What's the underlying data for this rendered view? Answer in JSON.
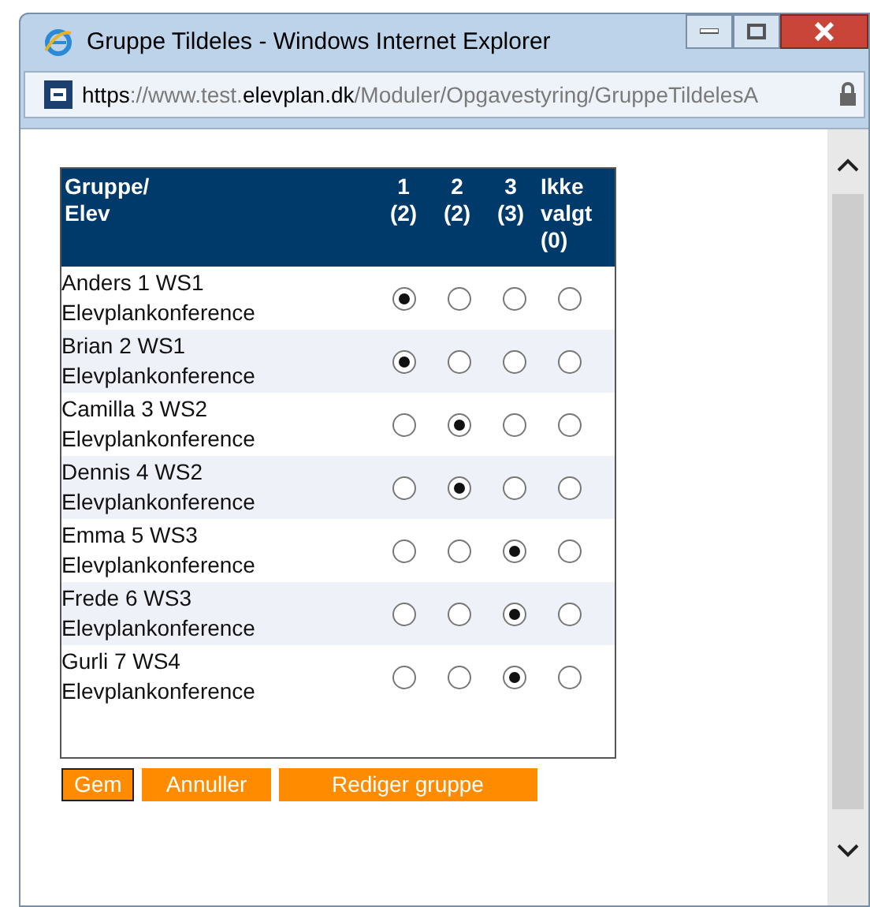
{
  "window": {
    "title": "Gruppe Tildeles - Windows Internet Explorer"
  },
  "address_bar": {
    "url_parts": [
      {
        "text": "https",
        "emphasis": true
      },
      {
        "text": "://www.test.",
        "emphasis": false
      },
      {
        "text": "elevplan.dk",
        "emphasis": true
      },
      {
        "text": "/Moduler/Opgavestyring/GruppeTildelesA",
        "emphasis": false
      }
    ]
  },
  "table": {
    "columns": [
      {
        "lines": [
          "Gruppe/",
          "Elev"
        ]
      },
      {
        "lines": [
          "1",
          "(2)"
        ]
      },
      {
        "lines": [
          "2",
          "(2)"
        ]
      },
      {
        "lines": [
          "3",
          "(3)"
        ]
      },
      {
        "lines": [
          "Ikke",
          "valgt",
          "(0)"
        ]
      }
    ],
    "rows": [
      {
        "name": "Anders 1 WS1",
        "subtitle": "Elevplankonference",
        "options": [
          {
            "selected": true
          },
          {
            "selected": false
          },
          {
            "selected": false
          },
          {
            "selected": false
          }
        ]
      },
      {
        "name": "Brian 2 WS1",
        "subtitle": "Elevplankonference",
        "options": [
          {
            "selected": true
          },
          {
            "selected": false
          },
          {
            "selected": false
          },
          {
            "selected": false
          }
        ]
      },
      {
        "name": "Camilla 3 WS2",
        "subtitle": "Elevplankonference",
        "options": [
          {
            "selected": false
          },
          {
            "selected": true
          },
          {
            "selected": false
          },
          {
            "selected": false
          }
        ]
      },
      {
        "name": "Dennis 4 WS2",
        "subtitle": "Elevplankonference",
        "options": [
          {
            "selected": false
          },
          {
            "selected": true
          },
          {
            "selected": false
          },
          {
            "selected": false
          }
        ]
      },
      {
        "name": "Emma 5 WS3",
        "subtitle": "Elevplankonference",
        "options": [
          {
            "selected": false
          },
          {
            "selected": false
          },
          {
            "selected": true
          },
          {
            "selected": false
          }
        ]
      },
      {
        "name": "Frede 6 WS3",
        "subtitle": "Elevplankonference",
        "options": [
          {
            "selected": false
          },
          {
            "selected": false
          },
          {
            "selected": true
          },
          {
            "selected": false
          }
        ]
      },
      {
        "name": "Gurli 7 WS4",
        "subtitle": "Elevplankonference",
        "options": [
          {
            "selected": false
          },
          {
            "selected": false
          },
          {
            "selected": true
          },
          {
            "selected": false
          }
        ]
      }
    ]
  },
  "buttons": [
    {
      "label": "Gem",
      "focused": true
    },
    {
      "label": "Annuller",
      "focused": false
    },
    {
      "label": "Rediger gruppe",
      "focused": false
    }
  ]
}
